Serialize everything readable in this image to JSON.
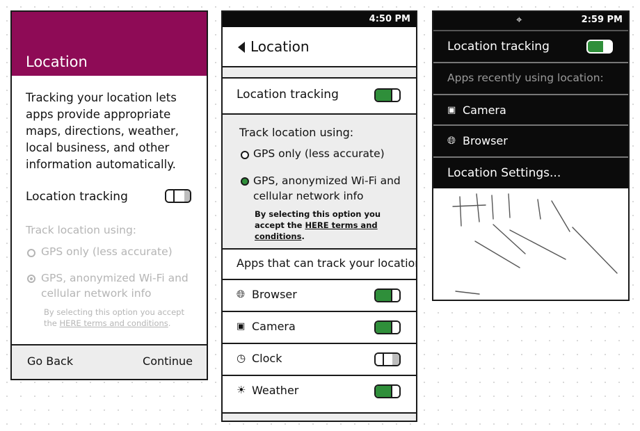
{
  "colors": {
    "header_magenta": "#8e0b56",
    "toggle_green": "#2f8f3a",
    "toggle_off_gray": "#bdbdbd",
    "dark_bg": "#0b0b0b",
    "light_panel": "#ededed",
    "disabled_text": "#b5b5b5"
  },
  "screen1": {
    "title": "Location",
    "description": "Tracking your location lets apps provide appropriate maps, directions, weather, local business, and other information automatically.",
    "tracking_label": "Location tracking",
    "tracking_on": false,
    "track_using_label": "Track location using:",
    "option_gps_only": "GPS only (less accurate)",
    "option_gps_wifi": "GPS, anonymized Wi-Fi and cellular network info",
    "accept_prefix": "By selecting this option you accept the",
    "accept_link": "HERE terms and conditions",
    "accept_suffix": ".",
    "go_back": "Go Back",
    "continue": "Continue"
  },
  "screen2": {
    "time": "4:50 PM",
    "back_icon": "triangle-left-icon",
    "title": "Location",
    "tracking_label": "Location tracking",
    "tracking_on": true,
    "track_using_label": "Track location using:",
    "option_gps_only": "GPS only (less accurate)",
    "option_gps_wifi": "GPS, anonymized Wi-Fi and cellular network info",
    "selected_option": "gps_wifi",
    "accept_prefix": "By selecting this option you accept the",
    "accept_link": "HERE terms and conditions",
    "accept_suffix": ".",
    "apps_header": "Apps that can track your location:",
    "apps": [
      {
        "name": "Browser",
        "icon": "globe-icon",
        "on": true
      },
      {
        "name": "Camera",
        "icon": "camera-icon",
        "on": true
      },
      {
        "name": "Clock",
        "icon": "clock-icon",
        "on": false
      },
      {
        "name": "Weather",
        "icon": "sun-cloud-icon",
        "on": true
      }
    ]
  },
  "screen3": {
    "status_icon": "location-target-icon",
    "time": "2:59 PM",
    "tracking_label": "Location tracking",
    "tracking_on": true,
    "recent_header": "Apps recently using location:",
    "recent_apps": [
      {
        "name": "Camera",
        "icon": "camera-icon"
      },
      {
        "name": "Browser",
        "icon": "globe-icon"
      }
    ],
    "settings_link": "Location Settings..."
  }
}
